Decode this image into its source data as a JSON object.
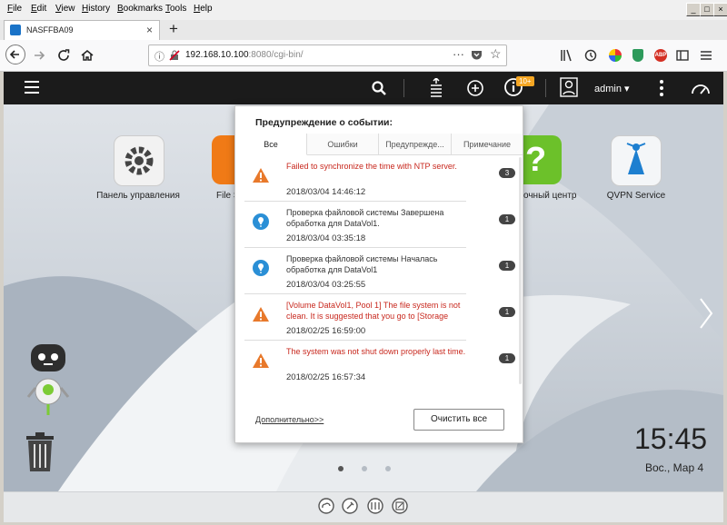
{
  "browser": {
    "menu": [
      "File",
      "Edit",
      "View",
      "History",
      "Bookmarks",
      "Tools",
      "Help"
    ],
    "tab_title": "NASFFBA09",
    "url_host": "192.168.10.100",
    "url_rest": ":8080/cgi-bin/",
    "window_buttons": [
      "_",
      "□",
      "×"
    ]
  },
  "qts": {
    "user": "admin ▾",
    "badge": "10+"
  },
  "desktop": {
    "apps": [
      {
        "label": "Панель управления"
      },
      {
        "label": "File S"
      },
      {
        "label": "очный центр"
      },
      {
        "label": "QVPN Service"
      }
    ],
    "time": "15:45",
    "date": "Вос., Мар 4"
  },
  "popup": {
    "title": "Предупреждение о событии:",
    "tabs": [
      "Все",
      "Ошибки",
      "Предупрежде...",
      "Примечание"
    ],
    "events": [
      {
        "text": "Failed to synchronize the time with NTP server.",
        "date": "2018/03/04 14:46:12",
        "count": "3",
        "level": "warning"
      },
      {
        "text": "Проверка файловой системы Завершена обработка для DataVol1.",
        "date": "2018/03/04 03:35:18",
        "count": "1",
        "level": "info"
      },
      {
        "text": "Проверка файловой системы Началась обработка для DataVol1",
        "date": "2018/03/04 03:25:55",
        "count": "1",
        "level": "info"
      },
      {
        "text": "[Volume DataVol1, Pool 1] The file system is not clean. It is suggested that you go to [Storage",
        "date": "2018/02/25 16:59:00",
        "count": "1",
        "level": "warning"
      },
      {
        "text": "The system was not shut down properly last time.",
        "date": "2018/02/25 16:57:34",
        "count": "1",
        "level": "warning"
      }
    ],
    "more_link": "Дополнительно>>",
    "clear_button": "Очистить все"
  },
  "colors": {
    "warning": "#e8792b",
    "info": "#2a8fd6",
    "error_text": "#c8281e",
    "topbar": "#1b1b1b",
    "badge": "#f5a623"
  }
}
